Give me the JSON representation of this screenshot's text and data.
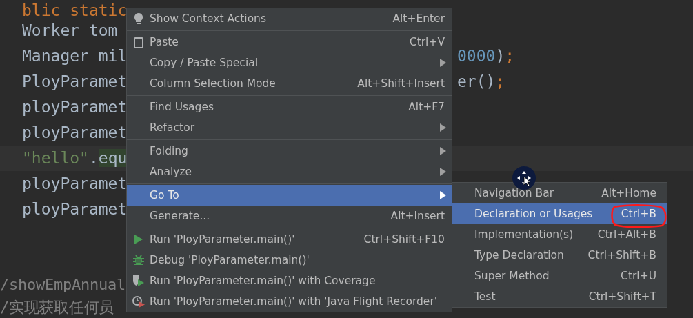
{
  "editor": {
    "lines": [
      {
        "current": false,
        "tokens": [
          {
            "kind": "keyword",
            "text": "blic static"
          }
        ]
      },
      {
        "current": false,
        "tokens": [
          {
            "kind": "plain",
            "text": "Worker tom"
          }
        ]
      },
      {
        "current": false,
        "tokens": [
          {
            "kind": "plain",
            "text": "Manager mil"
          }
        ],
        "fragment": [
          {
            "kind": "number",
            "text": "0000"
          },
          {
            "kind": "plain",
            "text": ")"
          },
          {
            "kind": "keyword",
            "text": ";"
          }
        ]
      },
      {
        "current": false,
        "tokens": [
          {
            "kind": "plain",
            "text": "PloyParamet"
          }
        ],
        "fragment": [
          {
            "kind": "plain",
            "text": "er()"
          },
          {
            "kind": "keyword",
            "text": ";"
          }
        ]
      },
      {
        "current": false,
        "tokens": [
          {
            "kind": "plain",
            "text": "ployParamet"
          }
        ]
      },
      {
        "current": false,
        "tokens": [
          {
            "kind": "plain",
            "text": "ployParamet"
          }
        ]
      },
      {
        "current": true,
        "tokens": [
          {
            "kind": "string",
            "text": "\"hello\""
          },
          {
            "kind": "plain",
            "text": "."
          },
          {
            "kind": "match",
            "text": "equ"
          }
        ]
      },
      {
        "current": false,
        "tokens": [
          {
            "kind": "plain",
            "text": "ployParamet"
          }
        ]
      },
      {
        "current": false,
        "tokens": [
          {
            "kind": "plain",
            "text": "ployParamet"
          }
        ]
      }
    ],
    "comment_lines": [
      {
        "current": false,
        "tokens": [
          {
            "kind": "comment",
            "text": "/showEmpAnnual"
          }
        ]
      },
      {
        "current": false,
        "tokens": [
          {
            "kind": "comment",
            "text": "/实现获取任何员"
          }
        ]
      }
    ]
  },
  "context_menu": {
    "groups": [
      [
        {
          "kind": "bulb",
          "label": "Show Context Actions",
          "shortcut": "Alt+Enter",
          "submenu": false,
          "selected": false
        }
      ],
      [
        {
          "kind": "clipboard",
          "label": "Paste",
          "shortcut": "Ctrl+V",
          "submenu": false,
          "selected": false
        },
        {
          "kind": "none",
          "label": "Copy / Paste Special",
          "submenu": true,
          "selected": false
        },
        {
          "kind": "none",
          "label": "Column Selection Mode",
          "shortcut": "Alt+Shift+Insert",
          "submenu": false,
          "selected": false
        }
      ],
      [
        {
          "kind": "none",
          "label": "Find Usages",
          "shortcut": "Alt+F7",
          "submenu": false,
          "selected": false
        },
        {
          "kind": "none",
          "label": "Refactor",
          "submenu": true,
          "selected": false
        }
      ],
      [
        {
          "kind": "none",
          "label": "Folding",
          "submenu": true,
          "selected": false
        },
        {
          "kind": "none",
          "label": "Analyze",
          "submenu": true,
          "selected": false
        }
      ],
      [
        {
          "kind": "none",
          "label": "Go To",
          "submenu": true,
          "selected": true
        },
        {
          "kind": "none",
          "label": "Generate...",
          "shortcut": "Alt+Insert",
          "submenu": false,
          "selected": false
        }
      ],
      [
        {
          "kind": "run",
          "label": "Run 'PloyParameter.main()'",
          "shortcut": "Ctrl+Shift+F10",
          "submenu": false,
          "selected": false
        },
        {
          "kind": "debug",
          "label": "Debug 'PloyParameter.main()'",
          "submenu": false,
          "selected": false
        },
        {
          "kind": "coverage",
          "label": "Run 'PloyParameter.main()' with Coverage",
          "submenu": false,
          "selected": false
        },
        {
          "kind": "profiler",
          "label": "Run 'PloyParameter.main()' with 'Java Flight Recorder'",
          "submenu": false,
          "selected": false
        }
      ]
    ]
  },
  "go_to_submenu": {
    "items": [
      {
        "label": "Navigation Bar",
        "shortcut": "Alt+Home",
        "selected": false
      },
      {
        "label": "Declaration or Usages",
        "shortcut": "Ctrl+B",
        "selected": true
      },
      {
        "label": "Implementation(s)",
        "shortcut": "Ctrl+Alt+B",
        "selected": false
      },
      {
        "label": "Type Declaration",
        "shortcut": "Ctrl+Shift+B",
        "selected": false
      },
      {
        "label": "Super Method",
        "shortcut": "Ctrl+U",
        "selected": false
      },
      {
        "label": "Test",
        "shortcut": "Ctrl+Shift+T",
        "selected": false
      }
    ]
  }
}
